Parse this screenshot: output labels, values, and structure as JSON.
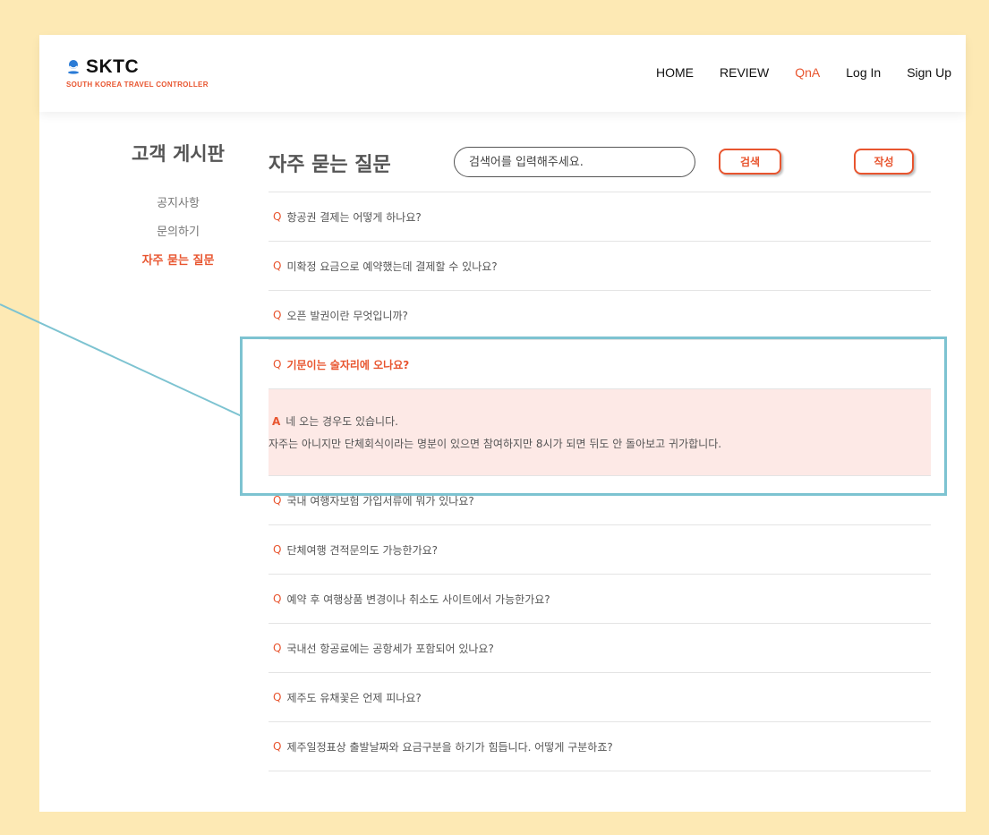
{
  "logo": {
    "title": "SKTC",
    "subtitle": "SOUTH KOREA TRAVEL CONTROLLER"
  },
  "nav": {
    "items": [
      "HOME",
      "REVIEW",
      "QnA",
      "Log In",
      "Sign Up"
    ],
    "active": "QnA"
  },
  "sidebar": {
    "title": "고객 게시판",
    "items": [
      "공지사항",
      "문의하기",
      "자주 묻는 질문"
    ],
    "active": "자주 묻는 질문"
  },
  "main": {
    "title": "자주 묻는 질문",
    "search_placeholder": "검색어를 입력해주세요.",
    "search_label": "검색",
    "write_label": "작성"
  },
  "faq": {
    "q_mark": "Q",
    "a_mark": "A",
    "questions": [
      "항공권 결제는 어떻게 하나요?",
      "미확정 요금으로 예약했는데 결제할 수 있나요?",
      "오픈 발권이란 무엇입니까?",
      "기문이는 술자리에 오나요?",
      "국내 여행자보험 가입서류에 뭐가 있나요?",
      "단체여행 견적문의도 가능한가요?",
      "예약 후 여행상품 변경이나 취소도 사이트에서 가능한가요?",
      "국내선 항공료에는 공항세가 포함되어 있나요?",
      "제주도 유채꽃은 언제 피나요?",
      "제주일정표상 출발날짜와 요금구분을 하기가 힘듭니다. 어떻게 구분하죠?"
    ],
    "open_answer": {
      "line1": "네 오는 경우도 있습니다.",
      "line2": "자주는 아니지만 단체회식이라는 명분이 있으면 참여하지만 8시가 되면 뒤도 안 돌아보고 귀가합니다."
    }
  },
  "colors": {
    "frame": "#fde9b4",
    "accent": "#e8552f",
    "answer_bg": "#fde9e6",
    "callout": "#7dc3d1"
  },
  "icons": {
    "logo": "globe-pin-icon"
  }
}
